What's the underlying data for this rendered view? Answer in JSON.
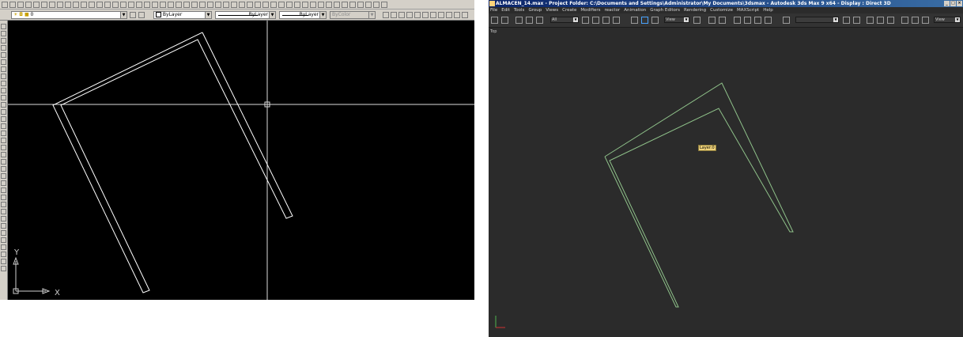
{
  "autocad": {
    "layer_combo": "0",
    "color_combo": "ByLayer",
    "linetype_combo": "ByLayer",
    "lineweight_combo": "ByLayer",
    "plotstyle_combo": "ByColor",
    "ucs_x": "X",
    "ucs_y": "Y",
    "colors": {
      "background": "#000000",
      "lines": "#ffffff",
      "ucs": "#cfcfcf"
    }
  },
  "max": {
    "title": "ALMACEN_14.max   - Project Folder: C:\\Documents and Settings\\Administrator\\My Documents\\3dsmax    - Autodesk 3ds Max 9 x64    - Display : Direct 3D",
    "menu": [
      "File",
      "Edit",
      "Tools",
      "Group",
      "Views",
      "Create",
      "Modifiers",
      "reactor",
      "Animation",
      "Graph Editors",
      "Rendering",
      "Customize",
      "MAXScript",
      "Help"
    ],
    "selection_filter": "All",
    "ref_coord": "View",
    "named_sel": "View",
    "viewport_label": "Top",
    "layer_tooltip": "Layer:0",
    "colors": {
      "background": "#2b2b2b",
      "lines": "#8fc28a"
    }
  }
}
